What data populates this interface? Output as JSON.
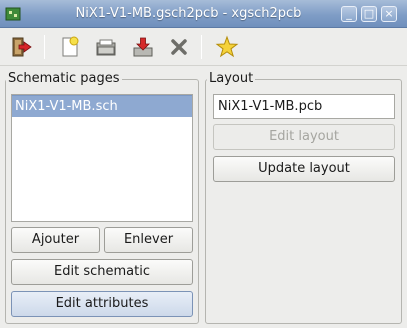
{
  "window": {
    "title": "NiX1-V1-MB.gsch2pcb - xgsch2pcb",
    "controls": {
      "minimize": "_",
      "maximize": "□",
      "close": "×"
    }
  },
  "toolbar": {
    "items": [
      {
        "icon": "exit-icon",
        "label": "Quit"
      },
      {
        "icon": "new-project-icon",
        "label": "New"
      },
      {
        "icon": "open-project-icon",
        "label": "Open"
      },
      {
        "icon": "save-project-icon",
        "label": "Save"
      },
      {
        "icon": "close-project-icon",
        "label": "Close"
      },
      {
        "icon": "about-icon",
        "label": "About"
      }
    ]
  },
  "schematic": {
    "frame_label": "Schematic pages",
    "pages": [
      "NiX1-V1-MB.sch"
    ],
    "selected_index": 0,
    "add_label": "Ajouter",
    "remove_label": "Enlever",
    "edit_schematic_label": "Edit schematic",
    "edit_attributes_label": "Edit attributes"
  },
  "layout": {
    "frame_label": "Layout",
    "pcb_file": "NiX1-V1-MB.pcb",
    "edit_layout_label": "Edit layout",
    "update_layout_label": "Update layout"
  },
  "colors": {
    "titlebar": "#7f9dc6",
    "selection": "#8ea9d1",
    "background": "#ededeb"
  }
}
